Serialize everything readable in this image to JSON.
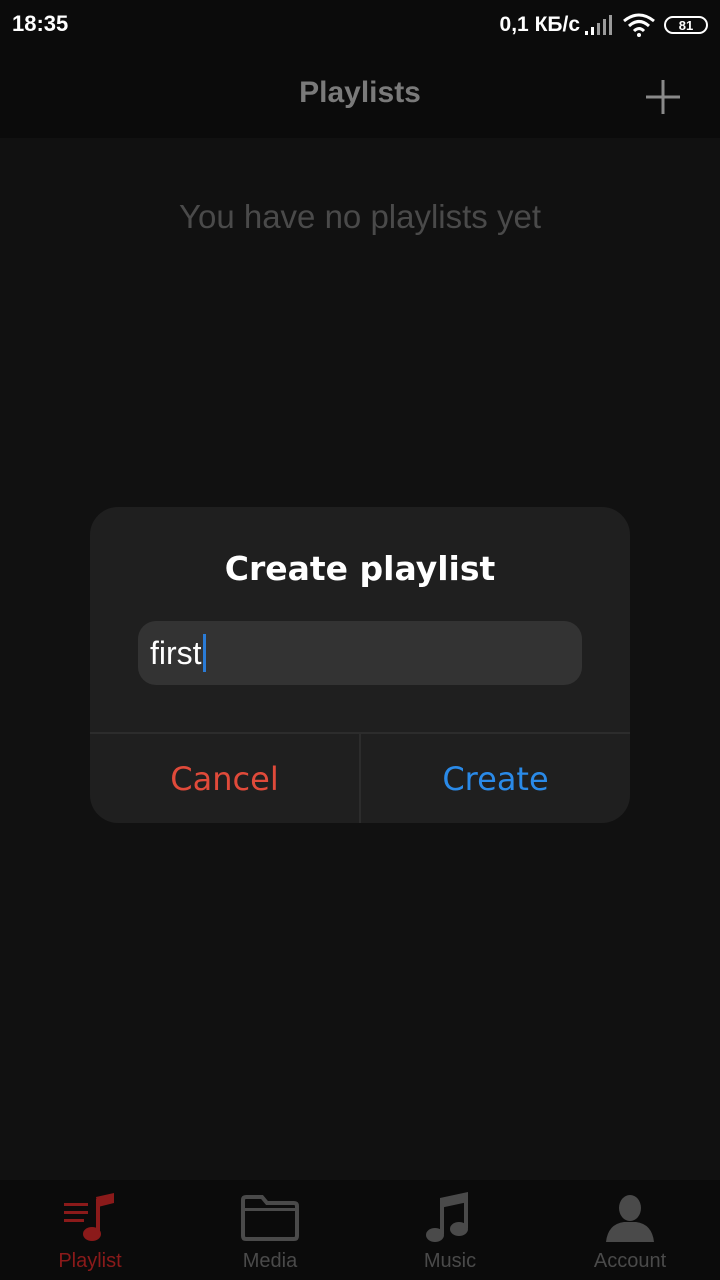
{
  "status_bar": {
    "time": "18:35",
    "speed": "0,1 КБ/с",
    "battery": "81"
  },
  "header": {
    "title": "Playlists"
  },
  "empty_message": "You have no playlists yet",
  "dialog": {
    "title": "Create playlist",
    "input_value": "first",
    "cancel_label": "Cancel",
    "create_label": "Create"
  },
  "bottom_nav": {
    "items": [
      {
        "label": "Playlist",
        "icon": "playlist-icon",
        "active": true
      },
      {
        "label": "Media",
        "icon": "folder-icon",
        "active": false
      },
      {
        "label": "Music",
        "icon": "music-note-icon",
        "active": false
      },
      {
        "label": "Account",
        "icon": "person-icon",
        "active": false
      }
    ]
  },
  "colors": {
    "background": "#111111",
    "bar": "#0b0b0b",
    "active_nav": "#8b1a1a",
    "inactive_nav": "#4a4a4a",
    "cancel": "#e04a3a",
    "create": "#2a8ae8"
  }
}
